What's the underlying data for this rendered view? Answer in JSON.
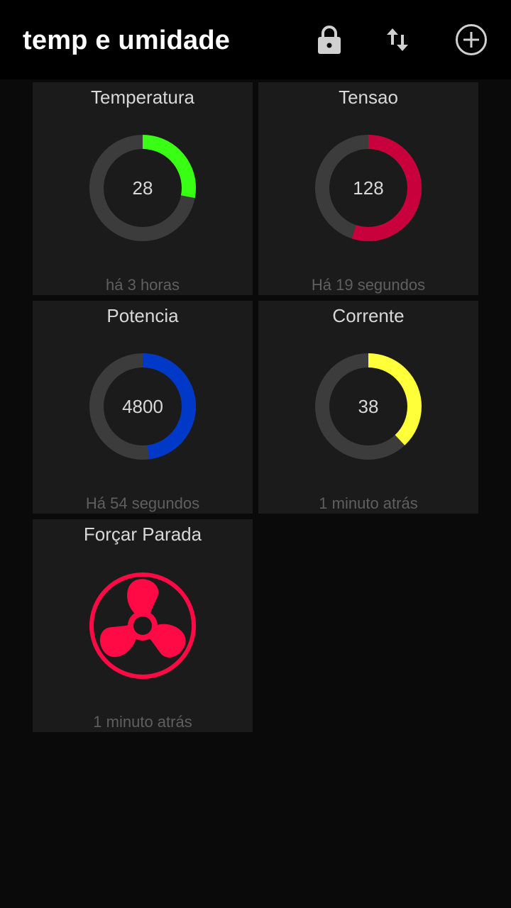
{
  "appbar": {
    "title": "temp e umidade",
    "icons": [
      "lock-icon",
      "swap-vertical-icon",
      "add-circle-icon"
    ]
  },
  "tiles": [
    {
      "title": "Temperatura",
      "value": "28",
      "level": 0.28,
      "color": "#39ff14",
      "time": "há 3 horas"
    },
    {
      "title": "Tensao",
      "value": "128",
      "level": 0.55,
      "color": "#c8003c",
      "time": "Há 19 segundos"
    },
    {
      "title": "Potencia",
      "value": "4800",
      "level": 0.48,
      "color": "#0038c8",
      "time": "Há 54 segundos"
    },
    {
      "title": "Corrente",
      "value": "38",
      "level": 0.38,
      "color": "#ffff3a",
      "time": "1 minuto atrás"
    },
    {
      "title": "Forçar Parada",
      "icon": "fan-icon",
      "color": "#ff0a44",
      "time": "1 minuto atrás"
    }
  ],
  "colors": {
    "background": "#0a0a0a",
    "appbar": "#000000",
    "tile": "#1b1b1b",
    "track": "#3c3c3c"
  }
}
